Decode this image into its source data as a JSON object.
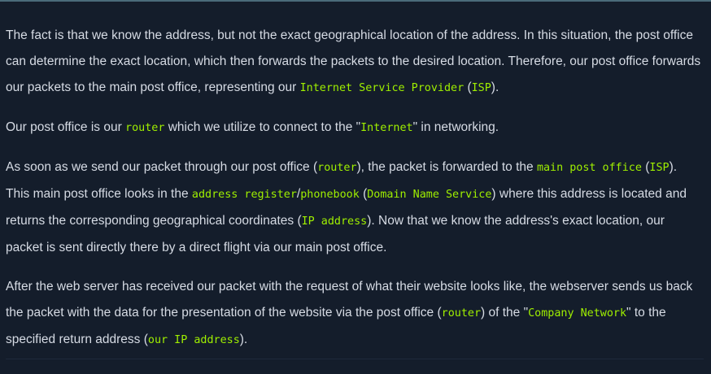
{
  "article": {
    "paragraphs": [
      {
        "segments": [
          {
            "t": "text",
            "v": "The fact is that we know the address, but not the exact geographical location of the address. In this situation, the post office can determine the exact location, which then forwards the packets to the desired location. Therefore, our post office forwards our packets to the main post office, representing our "
          },
          {
            "t": "code",
            "v": "Internet Service Provider"
          },
          {
            "t": "text",
            "v": " ("
          },
          {
            "t": "code",
            "v": "ISP"
          },
          {
            "t": "text",
            "v": ")."
          }
        ]
      },
      {
        "segments": [
          {
            "t": "text",
            "v": "Our post office is our "
          },
          {
            "t": "code",
            "v": "router"
          },
          {
            "t": "text",
            "v": " which we utilize to connect to the \""
          },
          {
            "t": "code",
            "v": "Internet"
          },
          {
            "t": "text",
            "v": "\" in networking."
          }
        ]
      },
      {
        "segments": [
          {
            "t": "text",
            "v": "As soon as we send our packet through our post office ("
          },
          {
            "t": "code",
            "v": "router"
          },
          {
            "t": "text",
            "v": "), the packet is forwarded to the "
          },
          {
            "t": "code",
            "v": "main post office"
          },
          {
            "t": "text",
            "v": " ("
          },
          {
            "t": "code",
            "v": "ISP"
          },
          {
            "t": "text",
            "v": "). This main post office looks in the "
          },
          {
            "t": "code",
            "v": "address register"
          },
          {
            "t": "text",
            "v": "/"
          },
          {
            "t": "code",
            "v": "phonebook"
          },
          {
            "t": "text",
            "v": " ("
          },
          {
            "t": "code",
            "v": "Domain Name Service"
          },
          {
            "t": "text",
            "v": ") where this address is located and returns the corresponding geographical coordinates ("
          },
          {
            "t": "code",
            "v": "IP address"
          },
          {
            "t": "text",
            "v": "). Now that we know the address's exact location, our packet is sent directly there by a direct flight via our main post office."
          }
        ]
      },
      {
        "segments": [
          {
            "t": "text",
            "v": "After the web server has received our packet with the request of what their website looks like, the webserver sends us back the packet with the data for the presentation of the website via the post office ("
          },
          {
            "t": "code",
            "v": "router"
          },
          {
            "t": "text",
            "v": ") of the \""
          },
          {
            "t": "code",
            "v": "Company Network"
          },
          {
            "t": "text",
            "v": "\" to the specified return address ("
          },
          {
            "t": "code",
            "v": "our IP address"
          },
          {
            "t": "text",
            "v": ")."
          }
        ]
      }
    ]
  },
  "colors": {
    "background": "#141d2b",
    "text": "#d6dbe4",
    "code_highlight": "#9fef00"
  }
}
